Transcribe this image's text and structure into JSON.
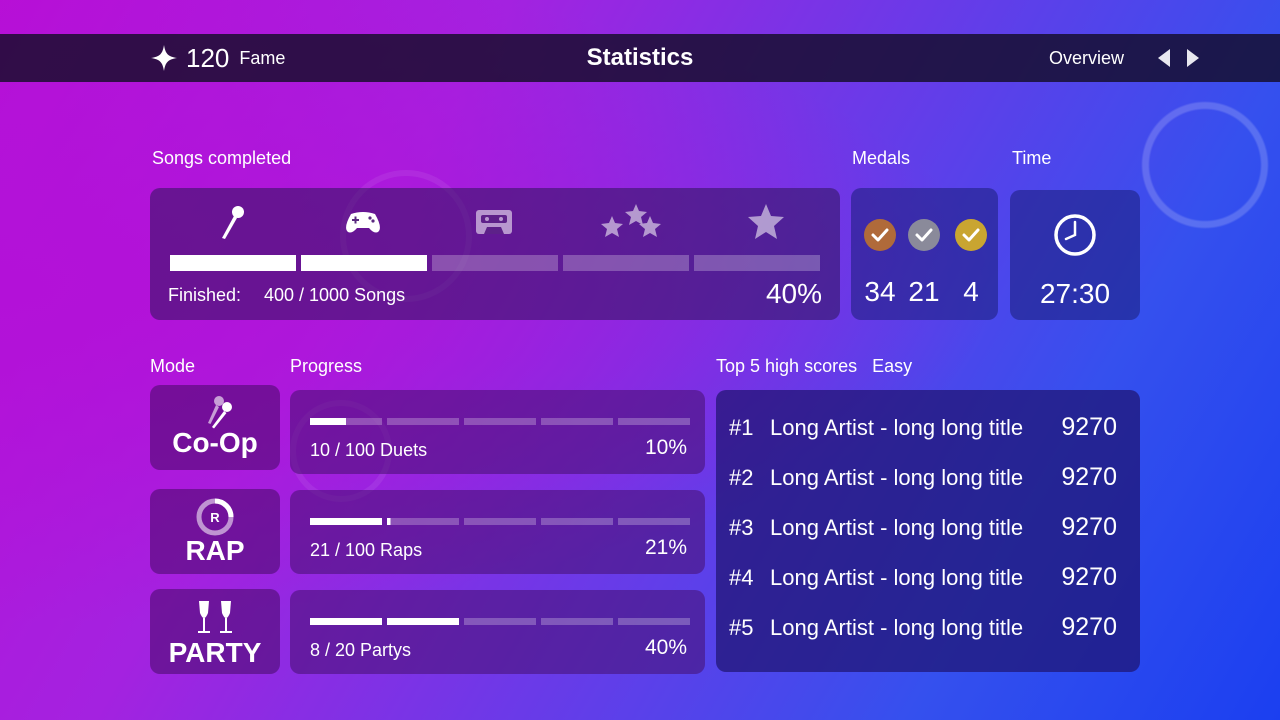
{
  "header": {
    "fame_value": "120",
    "fame_label": "Fame",
    "title": "Statistics",
    "view_label": "Overview"
  },
  "songs": {
    "section_label": "Songs completed",
    "icons": [
      "microphone-icon",
      "gamepad-icon",
      "cassette-icon",
      "stars-icon",
      "star-icon"
    ],
    "finished_label": "Finished:",
    "finished_value": "400 / 1000 Songs",
    "percent": "40%",
    "progress_fraction": 0.4
  },
  "medals": {
    "section_label": "Medals",
    "items": [
      {
        "name": "bronze",
        "color": "#b06a3a",
        "count": "34"
      },
      {
        "name": "silver",
        "color": "#8a8a9a",
        "count": "21"
      },
      {
        "name": "gold",
        "color": "#c9a531",
        "count": "4"
      }
    ]
  },
  "time": {
    "section_label": "Time",
    "value": "27:30"
  },
  "modes": {
    "mode_label": "Mode",
    "progress_label": "Progress",
    "items": [
      {
        "name": "Co-Op",
        "icon": "duet-microphones-icon",
        "progress_text": "10 / 100 Duets",
        "percent": "10%",
        "fraction": 0.1
      },
      {
        "name": "RAP",
        "icon": "rap-badge-icon",
        "progress_text": "21 / 100 Raps",
        "percent": "21%",
        "fraction": 0.21
      },
      {
        "name": "PARTY",
        "icon": "champagne-glasses-icon",
        "progress_text": "8 / 20 Partys",
        "percent": "40%",
        "fraction": 0.4
      }
    ]
  },
  "highscores": {
    "section_label": "Top 5 high scores",
    "difficulty": "Easy",
    "rows": [
      {
        "rank": "#1",
        "title": "Long Artist - long long title",
        "score": "9270"
      },
      {
        "rank": "#2",
        "title": "Long Artist - long long title",
        "score": "9270"
      },
      {
        "rank": "#3",
        "title": "Long Artist - long long title",
        "score": "9270"
      },
      {
        "rank": "#4",
        "title": "Long Artist - long long title",
        "score": "9270"
      },
      {
        "rank": "#5",
        "title": "Long Artist - long long title",
        "score": "9270"
      }
    ]
  },
  "colors": {
    "bar_fill": "#ffffff",
    "bar_empty": "rgba(255,255,255,0.25)"
  }
}
